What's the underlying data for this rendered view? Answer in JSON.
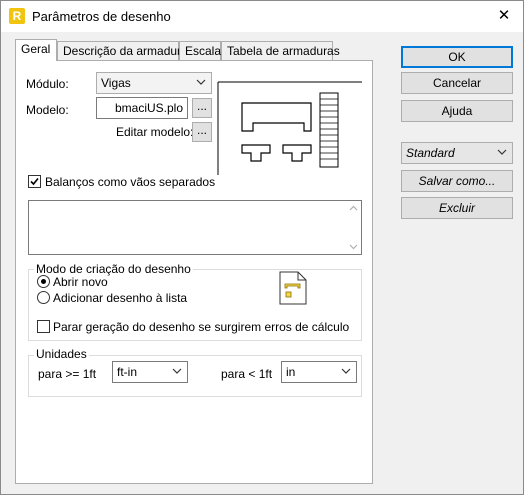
{
  "window": {
    "title": "Parâmetros de desenho",
    "app_icon_letter": "R",
    "close_glyph": "✕"
  },
  "tabs": [
    {
      "label": "Geral",
      "active": true
    },
    {
      "label": "Descrição da armadura",
      "active": false
    },
    {
      "label": "Escala",
      "active": false
    },
    {
      "label": "Tabela de armaduras",
      "active": false
    }
  ],
  "general": {
    "module_label": "Módulo:",
    "module_value": "Vigas",
    "model_label": "Modelo:",
    "model_value": "bmaciUS.plo",
    "browse_glyph": "...",
    "edit_model_label": "Editar modelo:",
    "cantilever_checkbox": {
      "label": "Balanços como vãos separados",
      "checked": true
    },
    "drawing_mode": {
      "title": "Modo de criação do desenho",
      "options": [
        {
          "label": "Abrir novo",
          "selected": true
        },
        {
          "label": "Adicionar desenho à lista",
          "selected": false
        }
      ],
      "stop_on_error": {
        "label": "Parar geração do desenho se surgirem erros de cálculo",
        "checked": false
      }
    },
    "units": {
      "title": "Unidades",
      "ge_label": "para >= 1ft",
      "ge_value": "ft-in",
      "lt_label": "para < 1ft",
      "lt_value": "in"
    }
  },
  "actions": {
    "ok": "OK",
    "cancel": "Cancelar",
    "help": "Ajuda",
    "template_value": "Standard",
    "save_as": "Salvar como...",
    "delete": "Excluir"
  }
}
